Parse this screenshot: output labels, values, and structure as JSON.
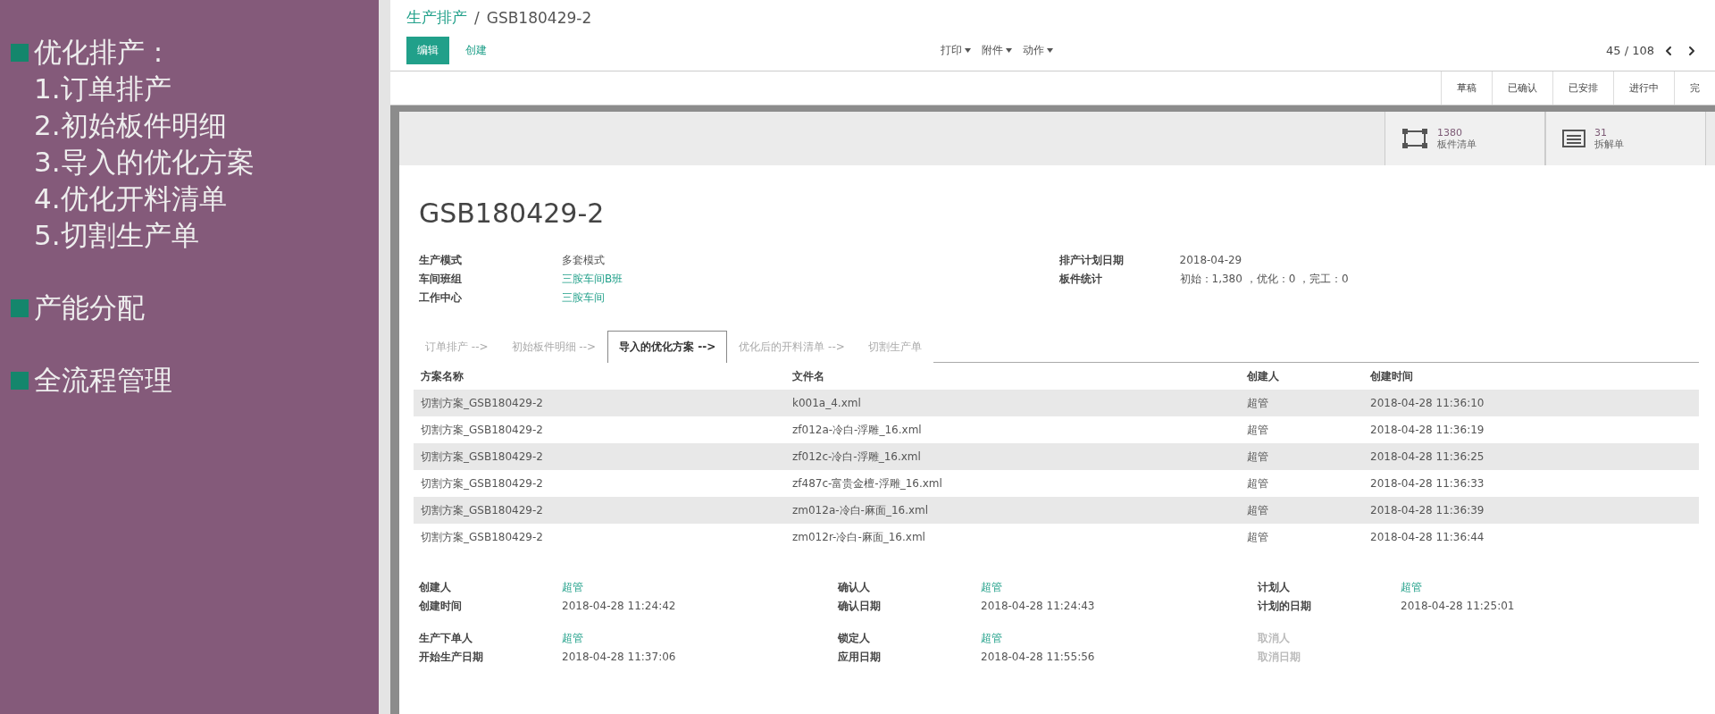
{
  "sidebar": {
    "sections": [
      {
        "title": "优化排产 :",
        "lines": [
          "1.订单排产",
          "2.初始板件明细",
          "3.导入的优化方案",
          "4.优化开料清单",
          "5.切割生产单"
        ]
      },
      {
        "title": "产能分配"
      },
      {
        "title": "全流程管理"
      }
    ]
  },
  "breadcrumb": {
    "parent": "生产排产",
    "separator": "/",
    "current": "GSB180429-2"
  },
  "buttons": [
    {
      "label": "编辑",
      "kind": "primary"
    },
    {
      "label": "创建",
      "kind": "link"
    }
  ],
  "menus": [
    "打印",
    "附件",
    "动作"
  ],
  "pager": {
    "text": "45 / 108"
  },
  "stages": [
    "草稿",
    "已确认",
    "已安排",
    "进行中",
    "完"
  ],
  "stat_buttons": [
    {
      "kind": "grid",
      "value": "1380",
      "label": "板件清单"
    },
    {
      "kind": "list",
      "value": "31",
      "label": "拆解单"
    }
  ],
  "title": "GSB180429-2",
  "fields_left": [
    {
      "label": "生产模式",
      "value": "多套模式",
      "kind": "text"
    },
    {
      "label": "车间班组",
      "value": "三胺车间B班",
      "kind": "link"
    },
    {
      "label": "工作中心",
      "value": "三胺车间",
      "kind": "link"
    }
  ],
  "fields_right": [
    {
      "label": "排产计划日期",
      "value": "2018-04-29"
    },
    {
      "label": "板件统计",
      "value": "初始：1,380 ，优化：0 ，完工：0"
    }
  ],
  "tabs": [
    {
      "label": "订单排产 -->",
      "selected": false
    },
    {
      "label": "初始板件明细 -->",
      "selected": false
    },
    {
      "label": "导入的优化方案 -->",
      "selected": true
    },
    {
      "label": "优化后的开料清单 -->",
      "selected": false
    },
    {
      "label": "切割生产单",
      "selected": false
    }
  ],
  "table": {
    "columns": [
      "方案名称",
      "文件名",
      "创建人",
      "创建时间"
    ],
    "rows": [
      [
        "切割方案_GSB180429-2",
        "k001a_4.xml",
        "超管",
        "2018-04-28 11:36:10"
      ],
      [
        "切割方案_GSB180429-2",
        "zf012a-冷白-浮雕_16.xml",
        "超管",
        "2018-04-28 11:36:19"
      ],
      [
        "切割方案_GSB180429-2",
        "zf012c-冷白-浮雕_16.xml",
        "超管",
        "2018-04-28 11:36:25"
      ],
      [
        "切割方案_GSB180429-2",
        "zf487c-富贵金檀-浮雕_16.xml",
        "超管",
        "2018-04-28 11:36:33"
      ],
      [
        "切割方案_GSB180429-2",
        "zm012a-冷白-麻面_16.xml",
        "超管",
        "2018-04-28 11:36:39"
      ],
      [
        "切割方案_GSB180429-2",
        "zm012r-冷白-麻面_16.xml",
        "超管",
        "2018-04-28 11:36:44"
      ]
    ]
  },
  "footer": [
    [
      [
        {
          "label": "创建人",
          "value": "超管",
          "kind": "link",
          "disabled": false
        },
        {
          "label": "创建时间",
          "value": "2018-04-28 11:24:42",
          "kind": "text",
          "disabled": false
        }
      ],
      [
        {
          "label": "确认人",
          "value": "超管",
          "kind": "link",
          "disabled": false
        },
        {
          "label": "确认日期",
          "value": "2018-04-28 11:24:43",
          "kind": "text",
          "disabled": false
        }
      ],
      [
        {
          "label": "计划人",
          "value": "超管",
          "kind": "link",
          "disabled": false
        },
        {
          "label": "计划的日期",
          "value": "2018-04-28 11:25:01",
          "kind": "text",
          "disabled": false
        }
      ]
    ],
    [
      [
        {
          "label": "生产下单人",
          "value": "超管",
          "kind": "link",
          "disabled": false
        },
        {
          "label": "开始生产日期",
          "value": "2018-04-28 11:37:06",
          "kind": "text",
          "disabled": false
        }
      ],
      [
        {
          "label": "锁定人",
          "value": "超管",
          "kind": "link",
          "disabled": false
        },
        {
          "label": "应用日期",
          "value": "2018-04-28 11:55:56",
          "kind": "text",
          "disabled": false
        }
      ],
      [
        {
          "label": "取消人",
          "disabled": true
        },
        {
          "label": "取消日期",
          "disabled": true
        }
      ]
    ]
  ]
}
